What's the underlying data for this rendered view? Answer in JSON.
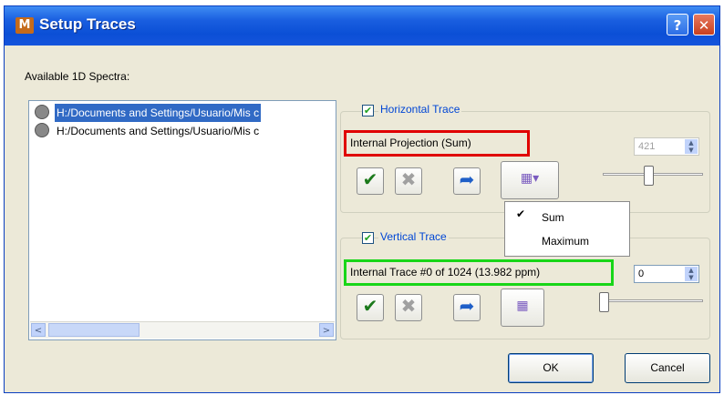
{
  "window": {
    "title": "Setup Traces",
    "app_icon_letter": "M",
    "help_label": "?",
    "close_label": "✕"
  },
  "spectra": {
    "label": "Available 1D Spectra:",
    "items": [
      {
        "text": "H:/Documents and Settings/Usuario/Mis c",
        "selected": true
      },
      {
        "text": "H:/Documents and Settings/Usuario/Mis c",
        "selected": false
      }
    ],
    "scroll_left": "<",
    "scroll_right": ">"
  },
  "horizontal": {
    "checked": true,
    "title": "Horizontal Trace",
    "source": "Internal Projection (Sum)",
    "spin_value": "421",
    "spin_enabled": false,
    "buttons": {
      "ok_icon": "✔",
      "remove_icon": "✖",
      "redo_icon": "➦",
      "projection_icon": "▦▾"
    }
  },
  "menu": {
    "items": [
      {
        "label": "Sum",
        "checked": true
      },
      {
        "label": "Maximum",
        "checked": false
      }
    ],
    "check_glyph": "✔"
  },
  "vertical": {
    "checked": true,
    "title": "Vertical Trace",
    "source": "Internal Trace #0 of 1024 (13.982 ppm)",
    "spin_value": "0",
    "buttons": {
      "ok_icon": "✔",
      "remove_icon": "✖",
      "redo_icon": "➦",
      "projection_icon": "▦"
    }
  },
  "footer": {
    "ok_label": "OK",
    "cancel_label": "Cancel"
  },
  "colors": {
    "title_bar": "#0b4fd6",
    "highlight_red": "#e00000",
    "highlight_green": "#18d618",
    "selection": "#316ac5"
  }
}
